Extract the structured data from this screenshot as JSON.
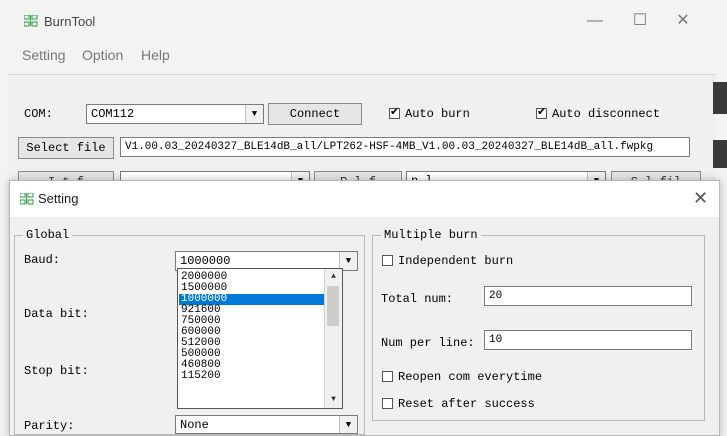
{
  "main_window": {
    "title": "BurnTool",
    "controls": {
      "minimize": "—",
      "maximize": "☐",
      "close": "✕"
    }
  },
  "menu": [
    "Setting",
    "Option",
    "Help"
  ],
  "main": {
    "com_label": "COM:",
    "com_value": "COM112",
    "connect_label": "Connect",
    "auto_burn_label": "Auto burn",
    "auto_burn_checked": true,
    "auto_disconnect_label": "Auto disconnect",
    "auto_disconnect_checked": true,
    "select_file_label": "Select file",
    "file_path": "V1.00.03_20240327_BLE14dB_all/LPT262-HSF-4MB_V1.00.03_20240327_BLE14dB_all.fwpkg",
    "partial_row": {
      "left": "I  t   f",
      "mid": "R  l f",
      "combo": "  p  l",
      "right": "S  l fil"
    }
  },
  "dialog": {
    "title": "Setting",
    "close": "✕",
    "global": {
      "title": "Global",
      "baud_label": "Baud:",
      "baud_value": "1000000",
      "baud_options": [
        "2000000",
        "1500000",
        "1000000",
        "921600",
        "750000",
        "600000",
        "512000",
        "500000",
        "460800",
        "115200"
      ],
      "baud_selected": "1000000",
      "data_bit_label": "Data bit:",
      "stop_bit_label": "Stop bit:",
      "parity_label": "Parity:",
      "parity_value": "None"
    },
    "multiple": {
      "title": "Multiple burn",
      "independent_label": "Independent burn",
      "independent_checked": false,
      "total_num_label": "Total num:",
      "total_num_value": "20",
      "num_per_line_label": "Num per line:",
      "num_per_line_value": "10",
      "reopen_label": "Reopen com everytime",
      "reopen_checked": false,
      "reset_label": "Reset after success",
      "reset_checked": false
    }
  },
  "colors": {
    "accent": "#0078d7",
    "icon": "#2e9e48"
  }
}
